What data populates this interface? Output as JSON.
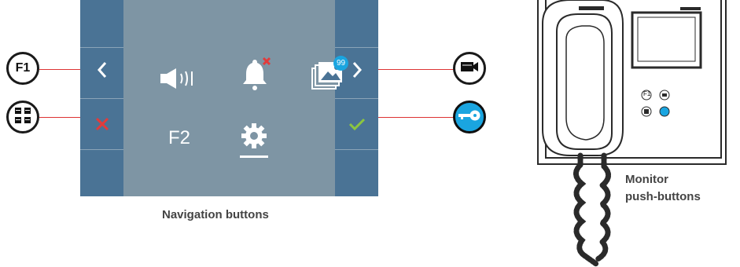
{
  "screen": {
    "f2_label": "F2",
    "badge_count": "99"
  },
  "side_buttons": {
    "f1_label": "F1"
  },
  "device": {
    "f1_label": "F1"
  },
  "captions": {
    "navigation": "Navigation buttons",
    "monitor_line1": "Monitor",
    "monitor_line2": "push-buttons"
  },
  "colors": {
    "screen_bg": "#7e95a4",
    "side_column": "#4a7395",
    "accent_red": "#e23b3b",
    "accent_green": "#8cc63f",
    "accent_blue": "#1aa5e0"
  }
}
